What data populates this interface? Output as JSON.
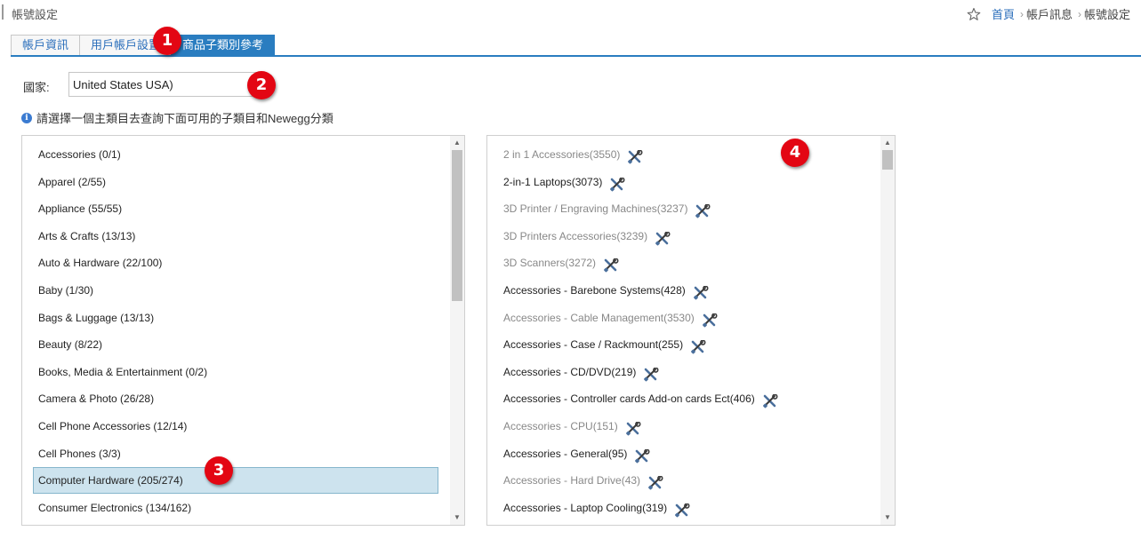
{
  "page_title": "帳號設定",
  "breadcrumb": {
    "home": "首頁",
    "items": [
      "帳戶訊息",
      "帳號設定"
    ]
  },
  "tabs": [
    {
      "label": "帳戶資訊",
      "active": false
    },
    {
      "label": "用戶帳戶設置",
      "active": false
    },
    {
      "label": "商品子類別參考",
      "active": true
    }
  ],
  "country": {
    "label": "國家:",
    "value": "United States USA)"
  },
  "info_text": "請選擇一個主類目去查詢下面可用的子類目和Newegg分類",
  "main_categories": [
    {
      "label": "Accessories (0/1)"
    },
    {
      "label": "Apparel (2/55)"
    },
    {
      "label": "Appliance (55/55)"
    },
    {
      "label": "Arts & Crafts (13/13)"
    },
    {
      "label": "Auto & Hardware (22/100)"
    },
    {
      "label": "Baby (1/30)"
    },
    {
      "label": "Bags & Luggage (13/13)"
    },
    {
      "label": "Beauty (8/22)"
    },
    {
      "label": "Books, Media & Entertainment (0/2)"
    },
    {
      "label": "Camera & Photo (26/28)"
    },
    {
      "label": "Cell Phone Accessories (12/14)"
    },
    {
      "label": "Cell Phones (3/3)"
    },
    {
      "label": "Computer Hardware (205/274)",
      "selected": true
    },
    {
      "label": "Consumer Electronics (134/162)"
    }
  ],
  "subcategories": [
    {
      "label": "2 in 1 Accessories(3550)",
      "muted": true
    },
    {
      "label": "2-in-1 Laptops(3073)",
      "muted": false
    },
    {
      "label": "3D Printer / Engraving Machines(3237)",
      "muted": true
    },
    {
      "label": "3D Printers Accessories(3239)",
      "muted": true
    },
    {
      "label": "3D Scanners(3272)",
      "muted": true
    },
    {
      "label": "Accessories - Barebone Systems(428)",
      "muted": false
    },
    {
      "label": "Accessories - Cable Management(3530)",
      "muted": true
    },
    {
      "label": "Accessories - Case / Rackmount(255)",
      "muted": false
    },
    {
      "label": "Accessories - CD/DVD(219)",
      "muted": false
    },
    {
      "label": "Accessories - Controller cards Add-on cards Ect(406)",
      "muted": false
    },
    {
      "label": "Accessories - CPU(151)",
      "muted": true
    },
    {
      "label": "Accessories - General(95)",
      "muted": false
    },
    {
      "label": "Accessories - Hard Drive(43)",
      "muted": true
    },
    {
      "label": "Accessories - Laptop Cooling(319)",
      "muted": false
    }
  ],
  "scroll_positions": {
    "left_fraction": 0.0,
    "right_fraction": 0.0
  },
  "markers": [
    "1",
    "2",
    "3",
    "4"
  ],
  "icons": {
    "star": "star-outline-icon",
    "tool": "tools-icon",
    "info": "info-icon"
  },
  "colors": {
    "accent": "#2a7dc0",
    "link": "#2a6ebb",
    "marker": "#e30613",
    "selected_bg": "#cde3ee",
    "muted_text": "#888888"
  }
}
